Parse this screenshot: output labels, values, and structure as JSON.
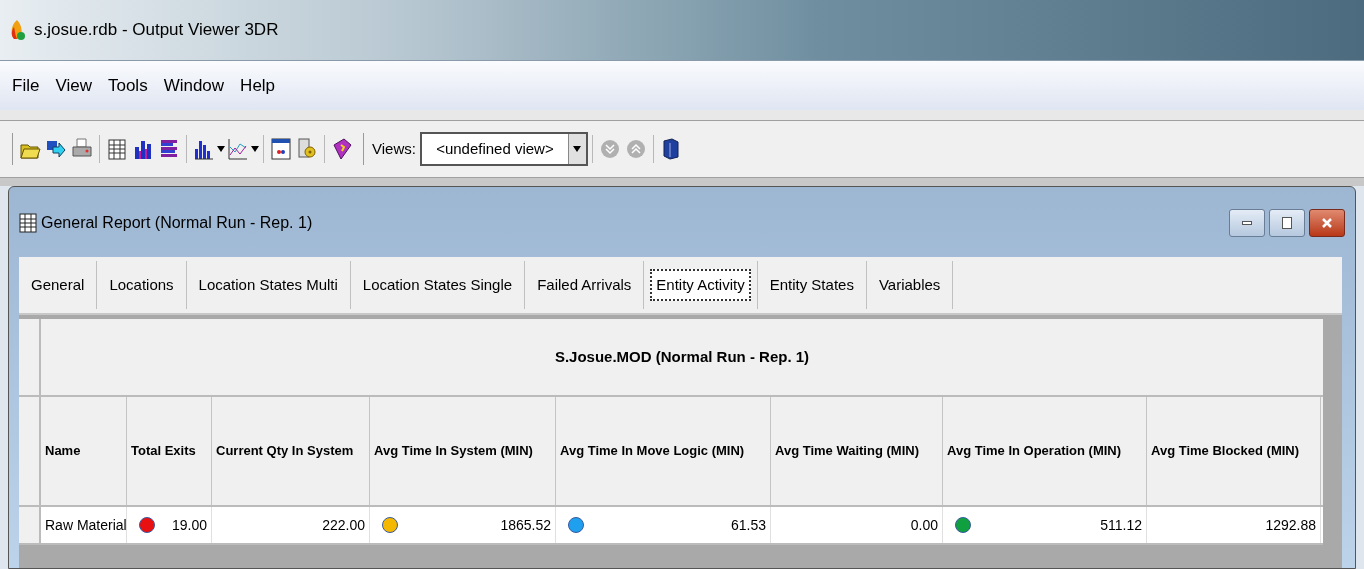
{
  "window": {
    "title": "s.josue.rdb - Output Viewer 3DR"
  },
  "menu": [
    "File",
    "View",
    "Tools",
    "Window",
    "Help"
  ],
  "toolbar": {
    "views_label": "Views:",
    "views_value": "<undefined view>"
  },
  "report": {
    "title": "General Report (Normal Run - Rep. 1)",
    "tabs": [
      {
        "label": "General",
        "selected": false
      },
      {
        "label": "Locations",
        "selected": false
      },
      {
        "label": "Location States Multi",
        "selected": false
      },
      {
        "label": "Location States Single",
        "selected": false
      },
      {
        "label": "Failed Arrivals",
        "selected": false
      },
      {
        "label": "Entity Activity",
        "selected": true
      },
      {
        "label": "Entity States",
        "selected": false
      },
      {
        "label": "Variables",
        "selected": false
      }
    ],
    "table": {
      "caption": "S.Josue.MOD (Normal Run - Rep. 1)",
      "columns": [
        "Name",
        "Total Exits",
        "Current Qty In System",
        "Avg Time In System (MIN)",
        "Avg Time In Move Logic (MIN)",
        "Avg Time Waiting (MIN)",
        "Avg Time In Operation (MIN)",
        "Avg Time Blocked (MIN)"
      ],
      "rows": [
        {
          "cells": [
            {
              "text": "Raw Material"
            },
            {
              "text": "19.00",
              "color": "#e81010"
            },
            {
              "text": "222.00"
            },
            {
              "text": "1865.52",
              "color": "#f5b800"
            },
            {
              "text": "61.53",
              "color": "#1ea0ee"
            },
            {
              "text": "0.00"
            },
            {
              "text": "511.12",
              "color": "#10a040"
            },
            {
              "text": "1292.88"
            }
          ]
        }
      ]
    }
  }
}
